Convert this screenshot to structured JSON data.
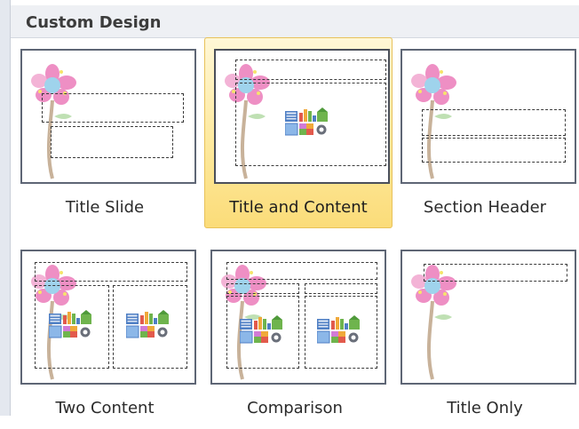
{
  "panel": {
    "title": "Custom Design"
  },
  "layouts": [
    {
      "label": "Title Slide"
    },
    {
      "label": "Title and Content",
      "selected": true
    },
    {
      "label": "Section Header"
    },
    {
      "label": "Two Content"
    },
    {
      "label": "Comparison"
    },
    {
      "label": "Title Only"
    }
  ],
  "colors": {
    "selection_fill": "#fde99e",
    "selection_border": "#e8c25a",
    "thumbnail_border": "#5e6675",
    "flower_petal": "#ee8fc4",
    "flower_center": "#9fd3ec",
    "stem": "#c8b29a"
  }
}
